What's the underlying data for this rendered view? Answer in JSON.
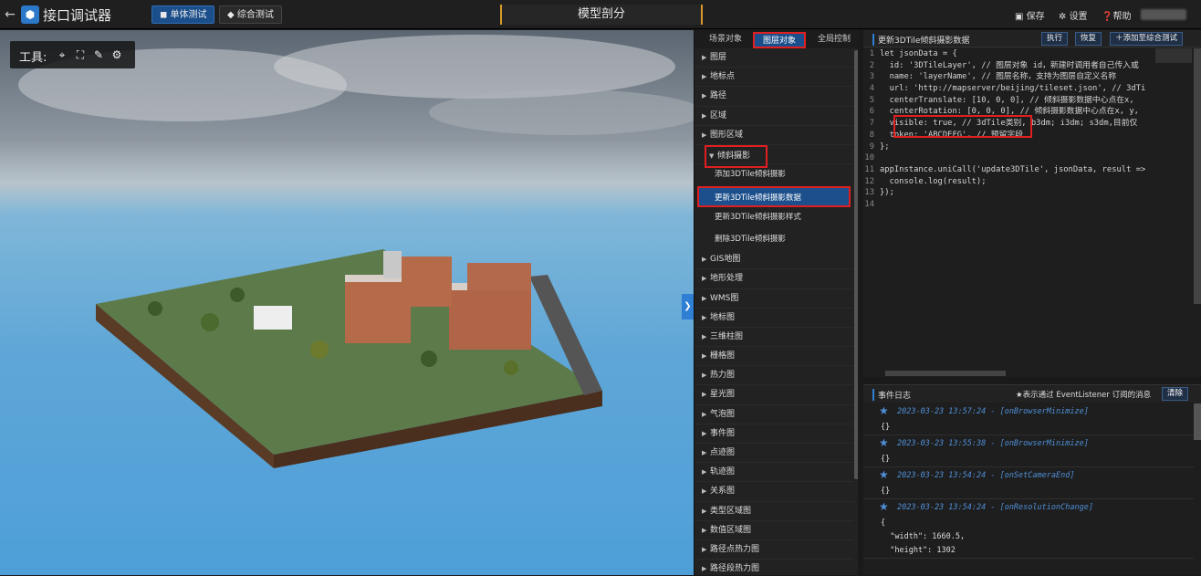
{
  "topbar": {
    "back_icon": "←",
    "logo_icon": "⬢",
    "title": "接口调试器",
    "unit_test": "单体测试",
    "combo_test": "综合测试",
    "center_title": "模型剖分",
    "save": "保存",
    "settings": "设置",
    "help": "帮助"
  },
  "viewport": {
    "tool_label": "工具:",
    "expander_icon": "❯"
  },
  "tabs": [
    "场景对象",
    "图层对象",
    "全局控制"
  ],
  "tree": {
    "items_top": [
      "图层",
      "地标点",
      "路径",
      "区域",
      "图形区域"
    ],
    "expanded": "倾斜摄影",
    "subitems": [
      "添加3DTile倾斜摄影",
      "更新3DTile倾斜摄影数据",
      "更新3DTile倾斜摄影样式",
      "删除3DTile倾斜摄影"
    ],
    "items_bottom": [
      "GIS地图",
      "地形处理",
      "WMS图",
      "地标图",
      "三维柱图",
      "栅格图",
      "热力图",
      "星光图",
      "气泡图",
      "事件图",
      "点迹图",
      "轨迹图",
      "关系图",
      "类型区域图",
      "数值区域图",
      "路径点热力图",
      "路径段热力图"
    ]
  },
  "editor": {
    "title": "更新3DTile倾斜摄影数据",
    "run": "执行",
    "reset": "恢复",
    "add": "添加至综合测试",
    "line_numbers": [
      "1",
      "2",
      "3",
      "4",
      "5",
      "6",
      "7",
      "8",
      "9",
      "10",
      "11",
      "12",
      "13",
      "14"
    ],
    "lines": [
      "let jsonData = {",
      "  id: '3DTileLayer', // 图层对象 id，新建时调用者自己传入或",
      "  name: 'layerName', // 图层名称，支持为图层自定义名称",
      "  url: 'http://mapserver/beijing/tileset.json', // 3dTi",
      "  centerTranslate: [10, 0, 0], // 倾斜摄影数据中心点在x,",
      "  centerRotation: [0, 0, 0], // 倾斜摄影数据中心点在x, y,",
      "  visible: true, // 3dTile类别, b3dm; i3dm; s3dm,目前仅",
      "  token: 'ABCDEFG', // 预留字段",
      "};",
      "",
      "appInstance.uniCall('update3DTile', jsonData, result =>",
      "  console.log(result);",
      "});",
      ""
    ]
  },
  "eventlog": {
    "title": "事件日志",
    "hint": "★表示通过 EventListener 订阅的消息",
    "clear": "清除",
    "events": [
      {
        "time": "2023-03-23 13:57:24 - [onBrowserMinimize]",
        "body": "{}"
      },
      {
        "time": "2023-03-23 13:55:38 - [onBrowserMinimize]",
        "body": "{}"
      },
      {
        "time": "2023-03-23 13:54:24 - [onSetCameraEnd]",
        "body": "{}"
      },
      {
        "time": "2023-03-23 13:54:24 - [onResolutionChange]",
        "body": "{\n  \"width\": 1660.5,\n  \"height\": 1302"
      }
    ]
  },
  "colors": {
    "accent": "#1b4f8c",
    "highlight": "#e02020",
    "event": "#4f8fd8"
  }
}
